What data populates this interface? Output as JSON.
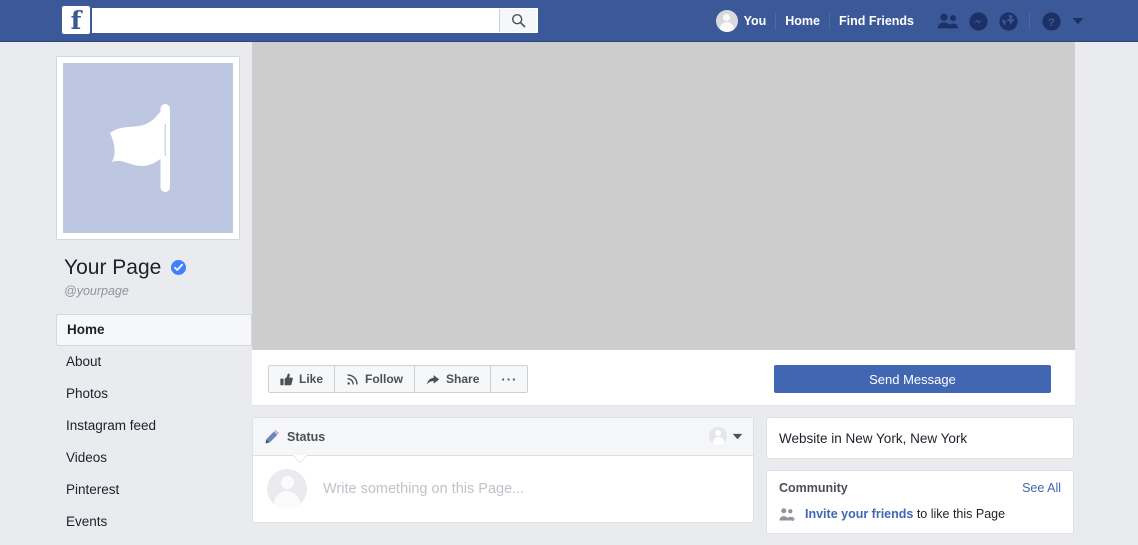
{
  "topnav": {
    "logo_letter": "f",
    "search": {
      "value": "",
      "placeholder": ""
    },
    "search_icon": "search-icon",
    "you_label": "You",
    "home_label": "Home",
    "find_friends_label": "Find Friends",
    "icons": [
      "friend-requests-icon",
      "messenger-icon",
      "notifications-globe-icon",
      "help-icon",
      "account-dropdown-caret-icon"
    ],
    "background_color": "#3b5998"
  },
  "profile": {
    "picture_placeholder_icon": "page-flag-icon",
    "picture_bg_color": "#bdc7e2",
    "name": "Your Page",
    "verified": true,
    "handle": "@yourpage"
  },
  "sidebar": {
    "items": [
      {
        "label": "Home",
        "active": true
      },
      {
        "label": "About",
        "active": false
      },
      {
        "label": "Photos",
        "active": false
      },
      {
        "label": "Instagram feed",
        "active": false
      },
      {
        "label": "Videos",
        "active": false
      },
      {
        "label": "Pinterest",
        "active": false
      },
      {
        "label": "Events",
        "active": false
      }
    ]
  },
  "cover": {
    "background_color": "#cdcdcd"
  },
  "actions": {
    "like_label": "Like",
    "like_icon": "thumbs-up-icon",
    "follow_label": "Follow",
    "follow_icon": "rss-follow-icon",
    "share_label": "Share",
    "share_icon": "share-arrow-icon",
    "more_label": "···",
    "more_icon": "ellipsis-icon",
    "send_message_label": "Send Message",
    "send_message_color": "#4267b2"
  },
  "composer": {
    "tab_label": "Status",
    "tab_icon": "pencil-icon",
    "audience_icon": "audience-avatar-icon",
    "audience_caret_icon": "chevron-down-icon",
    "placeholder": "Write something on this Page..."
  },
  "right_sidebar": {
    "about_text": "Website in New York, New York",
    "community": {
      "title": "Community",
      "see_all_label": "See All",
      "invite_icon": "add-friends-icon",
      "invite_link_label": "Invite your friends",
      "invite_rest_text": " to like this Page"
    }
  }
}
